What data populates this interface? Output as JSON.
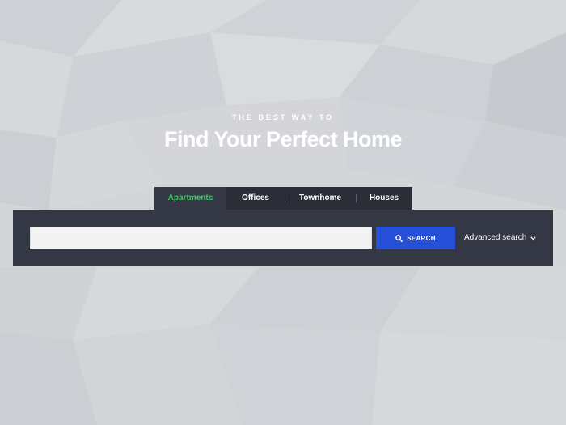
{
  "hero": {
    "eyebrow": "THE BEST WAY TO",
    "headline": "Find Your Perfect Home"
  },
  "tabs": [
    {
      "label": "Apartments",
      "active": true
    },
    {
      "label": "Offices",
      "active": false
    },
    {
      "label": "Townhome",
      "active": false
    },
    {
      "label": "Houses",
      "active": false
    }
  ],
  "search": {
    "value": "",
    "placeholder": "",
    "button_label": "SEARCH",
    "button_icon": "search-icon",
    "advanced_label": "Advanced search",
    "advanced_icon": "chevron-down-icon"
  },
  "colors": {
    "accent": "#2750d9",
    "active_tab_text": "#3ec767",
    "panel_bg": "#343844",
    "tab_bg": "#2b2e37"
  }
}
